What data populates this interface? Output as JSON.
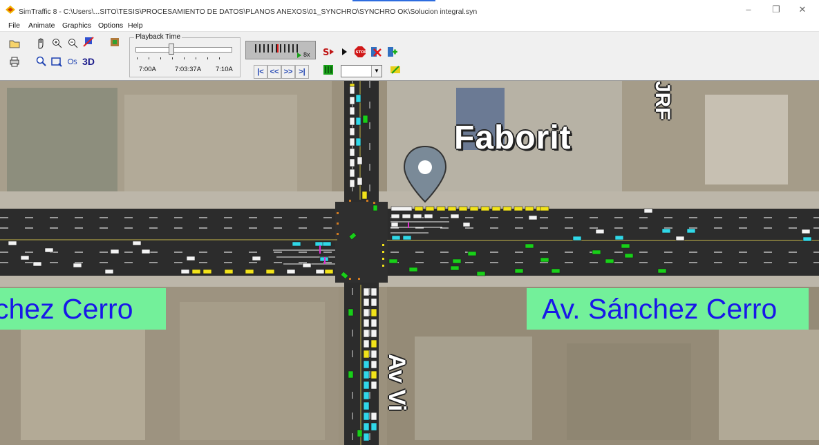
{
  "window": {
    "title": "SimTraffic 8 - C:\\Users\\...SITO\\TESIS\\PROCESAMIENTO DE DATOS\\PLANOS ANEXOS\\01_SYNCHRO\\SYNCHRO OK\\Solucion integral.syn",
    "minimize": "–",
    "restore": "❐",
    "close": "✕"
  },
  "menu": {
    "items": [
      "File",
      "Animate",
      "Graphics",
      "Options",
      "Help"
    ]
  },
  "toolbar": {
    "playback_label": "Playback Time",
    "time_start": "7:00A",
    "time_current": "7:03:37A",
    "time_end": "7:10A",
    "speed": "8x",
    "three_d_label": "3D",
    "buttons": [
      "open-icon",
      "print-icon",
      "pan-icon",
      "zoom-in-icon",
      "zoom-out-icon",
      "zoom-window-icon",
      "zoom-scale-icon",
      "map-signals-icon",
      "network-icon",
      "step-icon",
      "play-icon",
      "stop-icon",
      "cancel-record-icon",
      "record-icon",
      "run-icon",
      "cars-icon"
    ],
    "nav": [
      "|<",
      "<<",
      ">>",
      ">|"
    ],
    "zoom_value": ""
  },
  "map": {
    "labels": {
      "street_left": "chez Cerro",
      "street_right": "Av. Sánchez Cerro",
      "place": "Faborit",
      "vertical_street_top": "JRF",
      "vertical_street_bottom": "Av Vi"
    },
    "colors": {
      "road": "#2c2c2c",
      "label_bg": "#73f09a",
      "label_text": "#1818e8",
      "vehicle_white": "#ffffff",
      "vehicle_yellow": "#f2e31a",
      "vehicle_green": "#18d018",
      "vehicle_cyan": "#30d8e8"
    }
  }
}
